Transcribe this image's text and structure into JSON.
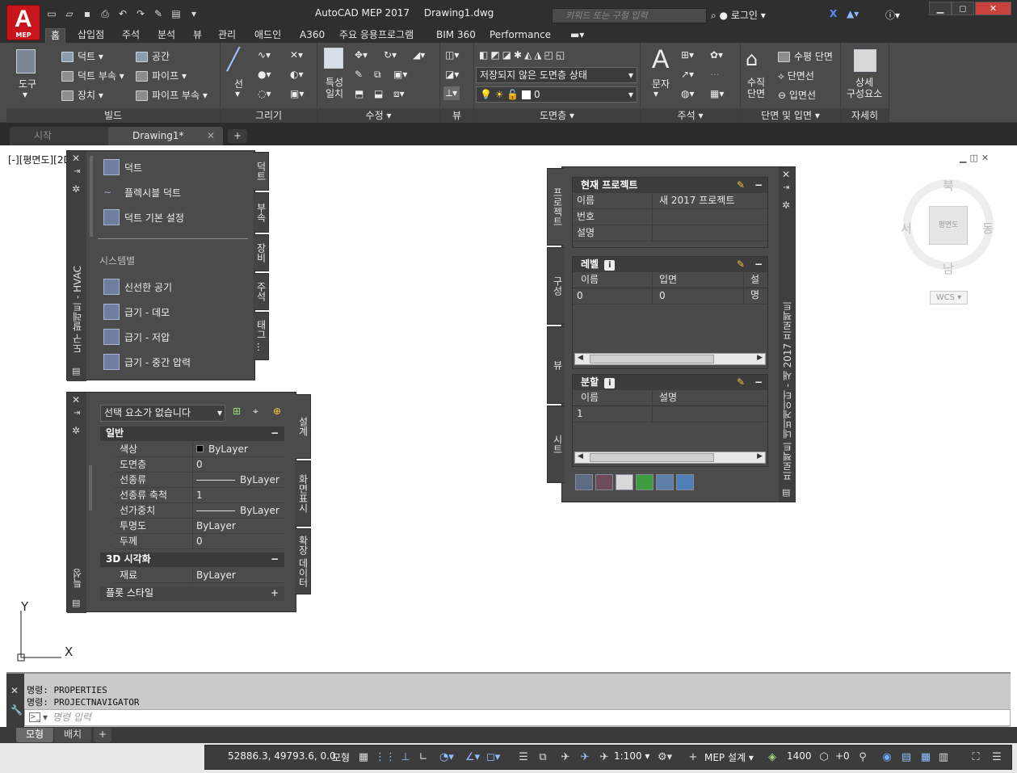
{
  "app": {
    "logo_letter": "A",
    "logo_sub": "MEP",
    "title": "AutoCAD MEP 2017",
    "document": "Drawing1.dwg",
    "search_placeholder": "키워드 또는 구절 입력",
    "login": "로그인"
  },
  "ribbon_tabs": [
    "홈",
    "삽입점",
    "주석",
    "분석",
    "뷰",
    "관리",
    "애드인",
    "A360",
    "주요 응용프로그램",
    "BIM 360",
    "Performance"
  ],
  "ribbon": {
    "build": {
      "title": "빌드",
      "tool_label": "도구",
      "items": [
        "덕트",
        "덕트 부속",
        "장치",
        "공간",
        "파이프",
        "파이프 부속"
      ]
    },
    "draw": {
      "title": "그리기",
      "line_label": "선"
    },
    "modify": {
      "title": "수정",
      "match_label_1": "특성",
      "match_label_2": "일치"
    },
    "view": {
      "title": "뷰"
    },
    "layers": {
      "title": "도면층",
      "layer_state": "저장되지 않은 도면층 상태",
      "current_layer": "0"
    },
    "annotation": {
      "title": "주석",
      "text_label": "문자"
    },
    "section": {
      "title": "단면 및 입면",
      "vertical_1": "수직",
      "vertical_2": "단면",
      "items": [
        "수평 단면",
        "단면선",
        "입면선"
      ]
    },
    "detail": {
      "title": "자세히",
      "label_1": "상세",
      "label_2": "구성요소"
    }
  },
  "doc_tabs": [
    "시작",
    "Drawing1*"
  ],
  "viewport_label": "[-][평면도][2D",
  "tool_palette": {
    "title": "도구 팔레트 - HVAC",
    "items": [
      "덕트",
      "플렉시블 덕트",
      "덕트 기본 설정"
    ],
    "section": "시스템별",
    "system_items": [
      "신선한 공기",
      "급기 - 데모",
      "급기 - 저압",
      "급기 - 중간 압력"
    ],
    "tabs": [
      "덕트",
      "부속",
      "장비",
      "주석",
      "태그 ..."
    ]
  },
  "properties": {
    "title": "특성",
    "selection": "선택 요소가 없습니다",
    "general_header": "일반",
    "rows": [
      {
        "k": "색상",
        "v": "ByLayer"
      },
      {
        "k": "도면층",
        "v": "0"
      },
      {
        "k": "선종류",
        "v": "ByLayer"
      },
      {
        "k": "선종류 축척",
        "v": "1"
      },
      {
        "k": "선가중치",
        "v": "ByLayer"
      },
      {
        "k": "투명도",
        "v": "ByLayer"
      },
      {
        "k": "두께",
        "v": "0"
      }
    ],
    "viz_header": "3D 시각화",
    "material_k": "재료",
    "material_v": "ByLayer",
    "plot_header": "플롯 스타일",
    "tabs": [
      "설계",
      "화면표시",
      "확장 데이터"
    ]
  },
  "project_navigator": {
    "title": "프로젝트 네비게이터 - 새 2017 프로젝트",
    "side_tabs": [
      "프로젝트",
      "구성",
      "뷰",
      "시트"
    ],
    "current_header": "현재 프로젝트",
    "current_rows": [
      {
        "k": "이름",
        "v": "새 2017 프로젝트"
      },
      {
        "k": "번호",
        "v": ""
      },
      {
        "k": "설명",
        "v": ""
      }
    ],
    "levels_header": "레벨",
    "levels_cols": [
      "이름",
      "입면",
      "설명"
    ],
    "levels_rows": [
      [
        "0",
        "0",
        ""
      ]
    ],
    "divisions_header": "분할",
    "divisions_cols": [
      "이름",
      "설명"
    ],
    "divisions_rows": [
      [
        "1",
        ""
      ]
    ]
  },
  "navcube": {
    "north": "북",
    "south": "남",
    "east": "동",
    "west": "서",
    "face": "평면도",
    "wcs": "WCS"
  },
  "ucs": {
    "x": "X",
    "y": "Y"
  },
  "command": {
    "history": [
      "명령:  PROPERTIES",
      "명령:  PROJECTNAVIGATOR"
    ],
    "placeholder": "명령 입력"
  },
  "layout_tabs": [
    "모형",
    "배치"
  ],
  "status": {
    "coords": "52886.3, 49793.6, 0.0",
    "model": "모형",
    "scale": "1:100",
    "workspace": "MEP 설계",
    "elevation": "1400",
    "offset": "+0"
  },
  "colors": {
    "accent": "#c8141b",
    "ribbon_bg": "#4b4b4b",
    "titlebar_bg": "#2f2f2f"
  }
}
